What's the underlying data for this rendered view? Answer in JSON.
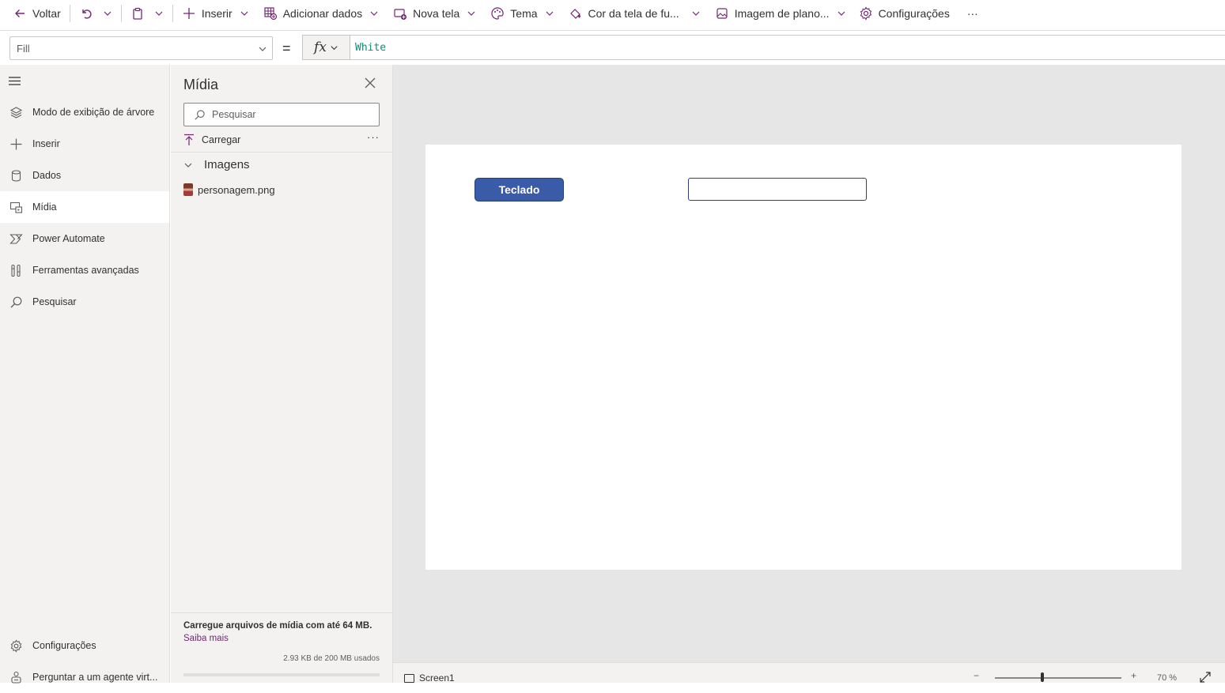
{
  "toolbar": {
    "back": "Voltar",
    "insert": "Inserir",
    "add_data": "Adicionar dados",
    "new_screen": "Nova tela",
    "theme": "Tema",
    "bg_color": "Cor da tela de fu...",
    "bg_image": "Imagem de plano...",
    "settings": "Configurações",
    "more": "···"
  },
  "formula": {
    "property": "Fill",
    "equals": "=",
    "fx": "fx",
    "value": "White"
  },
  "leftnav": {
    "items": [
      {
        "label": "Modo de exibição de árvore",
        "icon": "layers-icon"
      },
      {
        "label": "Inserir",
        "icon": "plus-icon"
      },
      {
        "label": "Dados",
        "icon": "database-icon"
      },
      {
        "label": "Mídia",
        "icon": "media-icon"
      },
      {
        "label": "Power Automate",
        "icon": "power-automate-icon"
      },
      {
        "label": "Ferramentas avançadas",
        "icon": "tools-icon"
      },
      {
        "label": "Pesquisar",
        "icon": "search-icon"
      }
    ],
    "bottom": [
      {
        "label": "Configurações",
        "icon": "gear-icon"
      },
      {
        "label": "Perguntar a um agente virt...",
        "icon": "bot-icon"
      }
    ],
    "active_index": 3
  },
  "media": {
    "title": "Mídia",
    "search_placeholder": "Pesquisar",
    "upload": "Carregar",
    "more": "···",
    "group": "Imagens",
    "files": [
      "personagem.png"
    ],
    "footer_text": "Carregue arquivos de mídia com até 64 MB.",
    "footer_link": "Saiba mais",
    "usage": "2.93 KB de 200 MB usados",
    "usage_fraction": 0.0
  },
  "canvas": {
    "button_label": "Teclado",
    "input_value": ""
  },
  "status": {
    "screen": "Screen1",
    "zoom": "70  %",
    "zoom_minus": "−",
    "zoom_plus": "+"
  },
  "colors": {
    "accent": "#742774",
    "button": "#3a5ba8",
    "formula_text": "#0f8a78"
  }
}
